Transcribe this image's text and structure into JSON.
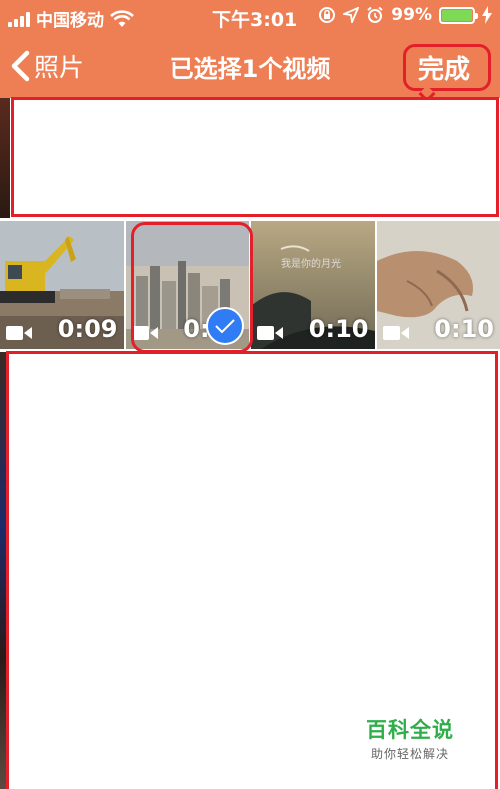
{
  "status_bar": {
    "carrier": "中国移动",
    "time": "下午3:01",
    "battery": "99%",
    "battery_level": 0.99,
    "icons": [
      "signal-icon",
      "wifi-icon",
      "rotation-lock-icon",
      "location-icon",
      "alarm-icon",
      "battery-icon",
      "charging-icon"
    ]
  },
  "nav": {
    "back_label": "照片",
    "title": "已选择1个视频",
    "done_label": "完成"
  },
  "videos": [
    {
      "duration": "0:09",
      "selected": false,
      "scene": "excavator"
    },
    {
      "duration": "0:10",
      "selected": true,
      "scene": "city-skyline"
    },
    {
      "duration": "0:10",
      "selected": false,
      "scene": "island-sunset",
      "overlay_text": "我是你的月光"
    },
    {
      "duration": "0:10",
      "selected": false,
      "scene": "hand"
    }
  ],
  "colors": {
    "header": "#ee7f54",
    "annotation": "#e3202a",
    "check": "#2f7cf5",
    "battery": "#7ed957",
    "watermark": "#2fae4a"
  },
  "watermark": {
    "title": "百科全说",
    "subtitle": "助你轻松解决"
  }
}
